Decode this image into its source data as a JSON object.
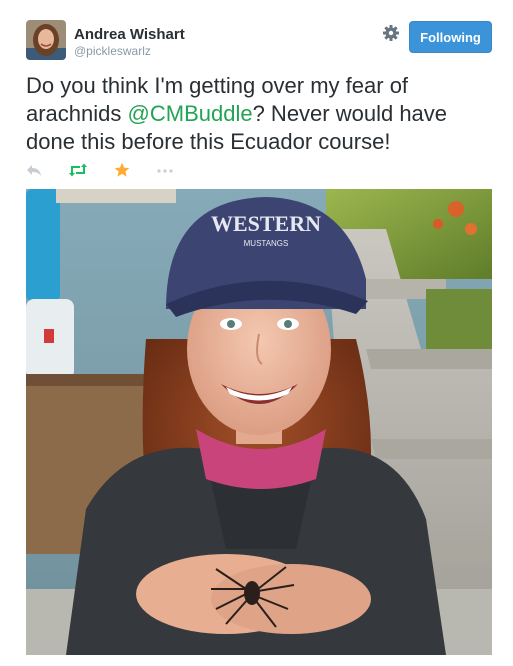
{
  "user": {
    "display_name": "Andrea Wishart",
    "handle": "@pickleswarlz",
    "avatar_icon": "profile-photo"
  },
  "header": {
    "follow_label": "Following",
    "settings_icon": "gear-icon"
  },
  "tweet": {
    "text_before": "Do you think I'm getting over my fear of arachnids ",
    "mention": "@CMBuddle",
    "text_after": "? Never would have done this before this Ecuador course!"
  },
  "actions": [
    {
      "name": "reply-icon"
    },
    {
      "name": "retweet-icon"
    },
    {
      "name": "favorite-icon"
    },
    {
      "name": "more-icon"
    }
  ],
  "photo": {
    "cap_text": "WESTERN",
    "cap_subtext": "MUSTANGS"
  },
  "colors": {
    "follow_button": "#3b94d9",
    "mention": "#23a454",
    "retweet": "#17bf63",
    "favorite": "#ffac33",
    "muted": "#8899a6"
  }
}
